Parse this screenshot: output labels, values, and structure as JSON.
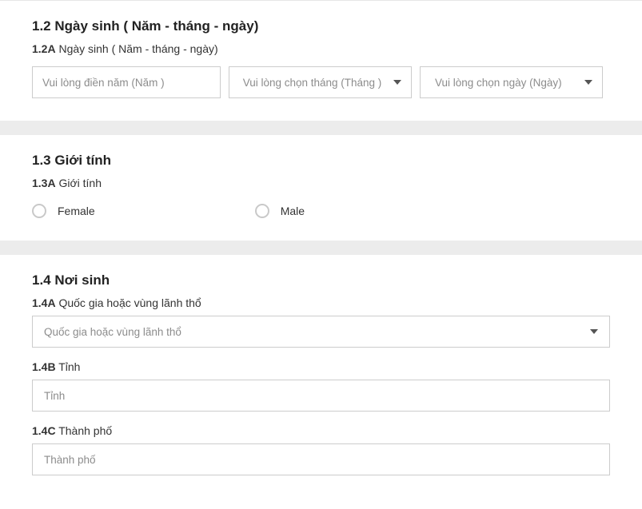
{
  "section12": {
    "title": "1.2 Ngày sinh ( Năm - tháng - ngày)",
    "sub_code": "1.2A",
    "sub_text": " Ngày sinh ( Năm - tháng - ngày)",
    "year_placeholder": "Vui lòng điền năm (Năm )",
    "month_placeholder": "Vui lòng chọn tháng (Tháng )",
    "day_placeholder": "Vui lòng chọn ngày (Ngày)"
  },
  "section13": {
    "title": "1.3 Giới tính",
    "sub_code": "1.3A",
    "sub_text": " Giới tính",
    "option_female": "Female",
    "option_male": "Male"
  },
  "section14": {
    "title": "1.4 Nơi sinh",
    "a_code": "1.4A",
    "a_text": " Quốc gia hoặc vùng lãnh thổ",
    "a_placeholder": "Quốc gia hoặc vùng lãnh thổ",
    "b_code": "1.4B",
    "b_text": " Tỉnh",
    "b_placeholder": "Tỉnh",
    "c_code": "1.4C",
    "c_text": " Thành phố",
    "c_placeholder": "Thành phố"
  }
}
